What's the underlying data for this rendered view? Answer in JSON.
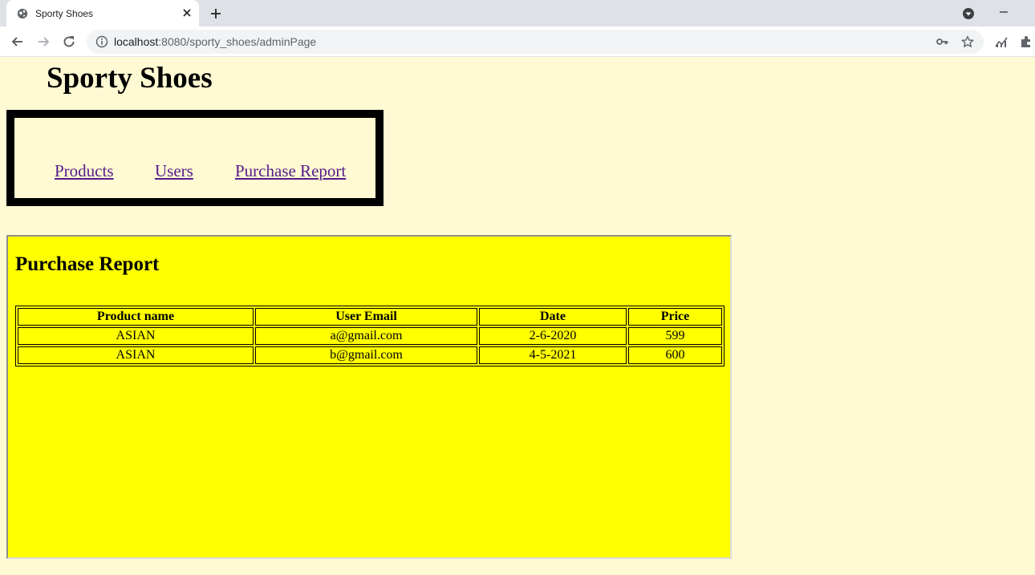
{
  "browser": {
    "tab_title": "Sporty Shoes",
    "url_host": "localhost",
    "url_rest": ":8080/sporty_shoes/adminPage"
  },
  "page": {
    "site_title": "Sporty Shoes",
    "nav": {
      "products": "Products",
      "users": "Users",
      "purchase_report": "Purchase Report"
    },
    "report": {
      "heading": "Purchase Report",
      "columns": [
        "Product name",
        "User Email",
        "Date",
        "Price"
      ],
      "rows": [
        [
          "ASIAN",
          "a@gmail.com",
          "2-6-2020",
          "599"
        ],
        [
          "ASIAN",
          "b@gmail.com",
          "4-5-2021",
          "600"
        ]
      ]
    }
  },
  "colors": {
    "page_background": "#fffad3",
    "panel_background": "#ffff00",
    "link": "#551a8b",
    "nav_border": "#000000"
  },
  "icons": {
    "tab": "globe-icon",
    "close": "close-icon",
    "new_tab": "plus-icon",
    "back": "back-arrow-icon",
    "forward": "forward-arrow-icon",
    "reload": "reload-icon",
    "info": "info-icon",
    "password": "key-icon",
    "bookmark": "star-icon",
    "extension_1": "chart-extension-icon",
    "extension_2": "puzzle-icon"
  }
}
